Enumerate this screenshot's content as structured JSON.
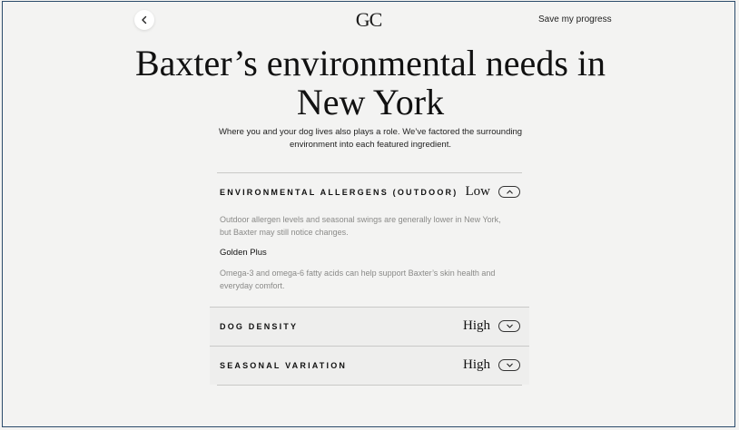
{
  "header": {
    "logo": "GC",
    "save_label": "Save my progress"
  },
  "page": {
    "title": "Baxter’s environmental needs in New York",
    "subtitle": "Where you and your dog lives also plays a role. We’ve factored the surrounding environment into each featured ingredient."
  },
  "accordion": [
    {
      "label": "ENVIRONMENTAL ALLERGENS (OUTDOOR)",
      "level": "Low",
      "expanded": true,
      "description": "Outdoor allergen levels and seasonal swings are generally lower in New York, but Baxter may still notice changes.",
      "ingredient": "Golden Plus",
      "ingredient_note": "Omega-3 and omega-6 fatty acids can help support Baxter’s skin health and everyday comfort."
    },
    {
      "label": "DOG DENSITY",
      "level": "High",
      "expanded": false
    },
    {
      "label": "SEASONAL VARIATION",
      "level": "High",
      "expanded": false
    }
  ],
  "icons": {
    "back": "chevron-left-icon",
    "collapse": "chevron-up-icon",
    "expand": "chevron-down-icon"
  }
}
